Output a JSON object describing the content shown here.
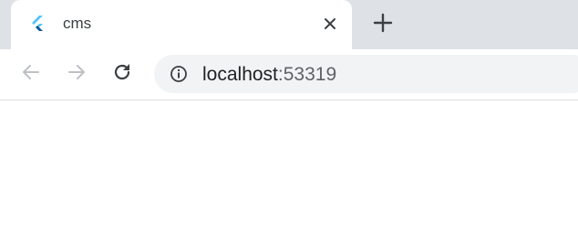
{
  "tab": {
    "title": "cms",
    "favicon": "flutter-logo-icon",
    "close_icon": "close-icon"
  },
  "new_tab_icon": "plus-icon",
  "toolbar": {
    "back_icon": "back-arrow-icon",
    "forward_icon": "forward-arrow-icon",
    "reload_icon": "reload-icon"
  },
  "omnibox": {
    "info_icon": "info-icon",
    "host": "localhost",
    "port": ":53319"
  },
  "colors": {
    "tab_strip": "#dee1e6",
    "omnibox_bg": "#f1f3f4",
    "flutter_light": "#54c5f8",
    "flutter_dark": "#01579b"
  }
}
